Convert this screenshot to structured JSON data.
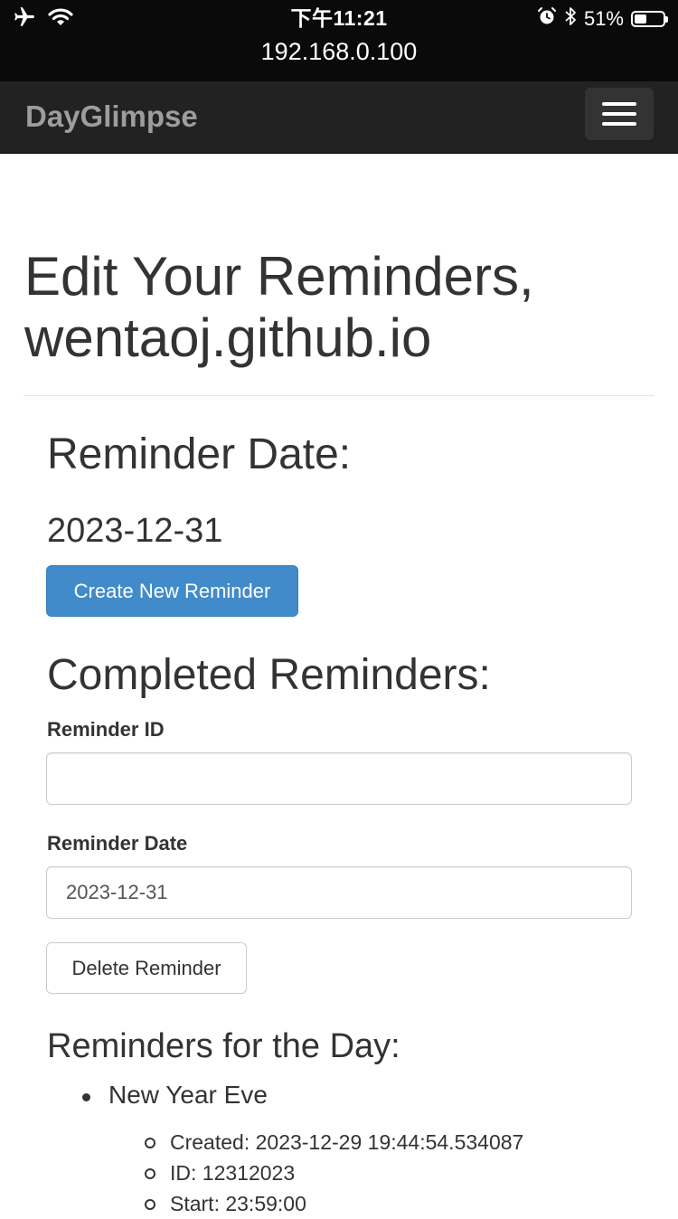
{
  "status_bar": {
    "time": "下午11:21",
    "url": "192.168.0.100",
    "battery_percent": "51%",
    "battery_level": 0.51,
    "left_icons": [
      "airplane-icon",
      "wifi-icon"
    ],
    "right_icons": [
      "alarm-icon",
      "bluetooth-icon",
      "battery-icon"
    ]
  },
  "navbar": {
    "brand": "DayGlimpse",
    "toggle_icon": "hamburger-menu-icon",
    "background": "#222222",
    "brand_color": "#9d9d9d"
  },
  "main": {
    "title_line1": "Edit Your Reminders,",
    "title_line2": "wentaoj.github.io",
    "reminder_date_heading": "Reminder Date:",
    "reminder_date_value": "2023-12-31",
    "create_button_label": "Create New Reminder",
    "completed_heading": "Completed Reminders:",
    "form": {
      "reminder_id_label": "Reminder ID",
      "reminder_id_value": "",
      "reminder_date_label": "Reminder Date",
      "reminder_date_value": "2023-12-31",
      "delete_button_label": "Delete Reminder"
    },
    "day_heading": "Reminders for the Day:",
    "reminders": [
      {
        "name": "New Year Eve",
        "details": [
          "Created: 2023-12-29 19:44:54.534087",
          "ID: 12312023",
          "Start: 23:59:00"
        ]
      }
    ]
  },
  "colors": {
    "primary": "#428bca",
    "text": "#333333",
    "border": "#cccccc"
  }
}
